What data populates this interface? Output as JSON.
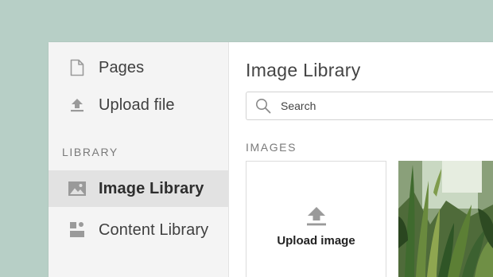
{
  "sidebar": {
    "items": [
      {
        "label": "Pages",
        "icon": "page-icon"
      },
      {
        "label": "Upload file",
        "icon": "upload-icon"
      }
    ],
    "section_label": "LIBRARY",
    "library_items": [
      {
        "label": "Image Library",
        "icon": "image-icon",
        "active": true
      },
      {
        "label": "Content Library",
        "icon": "content-blocks-icon",
        "active": false
      }
    ]
  },
  "main": {
    "title": "Image Library",
    "search": {
      "placeholder": "Search",
      "icon": "search-icon"
    },
    "images_label": "IMAGES",
    "upload_card": {
      "label": "Upload image",
      "icon": "upload-icon"
    },
    "thumbnail": {
      "subject": "snake plants photo"
    }
  },
  "colors": {
    "background": "#b7cfc6",
    "sidebar": "#f4f4f4",
    "active_item": "#e2e2e2",
    "icon_gray": "#9a9a9a"
  }
}
